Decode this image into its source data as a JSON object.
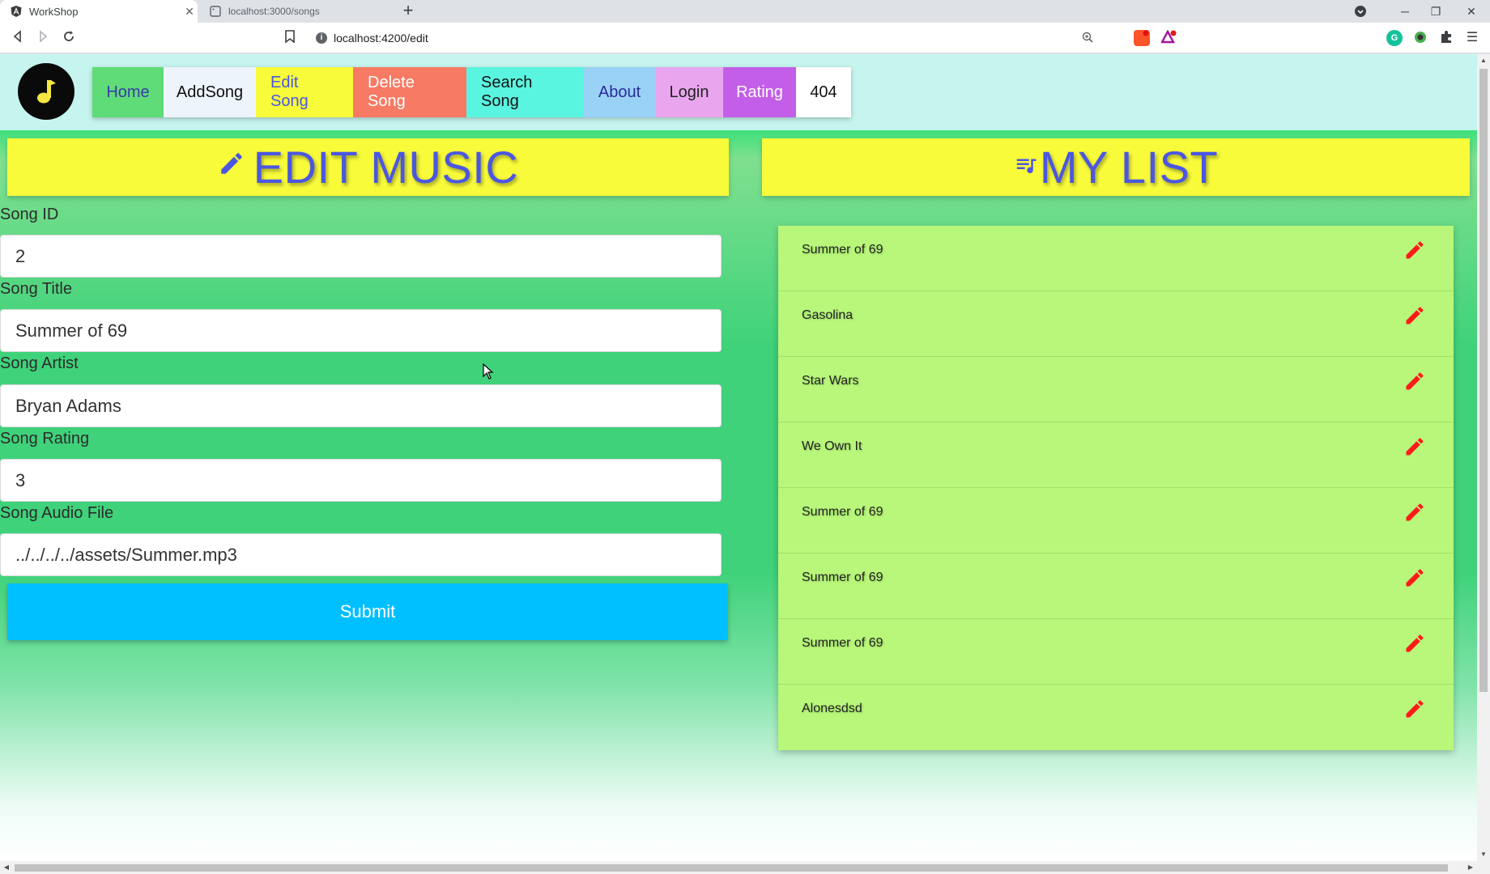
{
  "browser": {
    "tabs": [
      {
        "title": "WorkShop",
        "active": true
      },
      {
        "title": "localhost:3000/songs",
        "active": false
      }
    ],
    "url": "localhost:4200/edit"
  },
  "nav": {
    "items": [
      {
        "label": "Home",
        "bg": "#5fdc78",
        "color": "#3a3aaa"
      },
      {
        "label": "AddSong",
        "bg": "#eef4fb",
        "color": "#111111"
      },
      {
        "label": "Edit Song",
        "bg": "#f8fb3a",
        "color": "#4b57e0"
      },
      {
        "label": "Delete Song",
        "bg": "#f77a64",
        "color": "#ffffff"
      },
      {
        "label": "Search Song",
        "bg": "#5af5e1",
        "color": "#111111"
      },
      {
        "label": "About",
        "bg": "#9ad2f5",
        "color": "#2b2b9a"
      },
      {
        "label": "Login",
        "bg": "#e9a6ee",
        "color": "#222222"
      },
      {
        "label": "Rating",
        "bg": "#c35ee8",
        "color": "#ffffff"
      },
      {
        "label": "404",
        "bg": "#ffffff",
        "color": "#111111"
      }
    ]
  },
  "edit": {
    "title": "EDIT MUSIC",
    "fields": [
      {
        "label": "Song ID",
        "value": "2"
      },
      {
        "label": "Song Title",
        "value": "Summer of 69"
      },
      {
        "label": "Song Artist",
        "value": "Bryan Adams"
      },
      {
        "label": "Song Rating",
        "value": "3"
      },
      {
        "label": "Song Audio File",
        "value": "../../../../assets/Summer.mp3"
      }
    ],
    "submit_label": "Submit"
  },
  "list": {
    "title": "MY LIST",
    "items": [
      "Summer of 69",
      "Gasolina",
      "Star Wars",
      "We Own It",
      "Summer of 69",
      "Summer of 69",
      "Summer of 69",
      "Alonesdsd"
    ]
  },
  "colors": {
    "accent_blue": "#4b57e0",
    "header_yellow": "#f8fb3a",
    "submit_blue": "#00bfff",
    "list_green": "#b8f77a",
    "edit_red": "#ff1a1a"
  }
}
